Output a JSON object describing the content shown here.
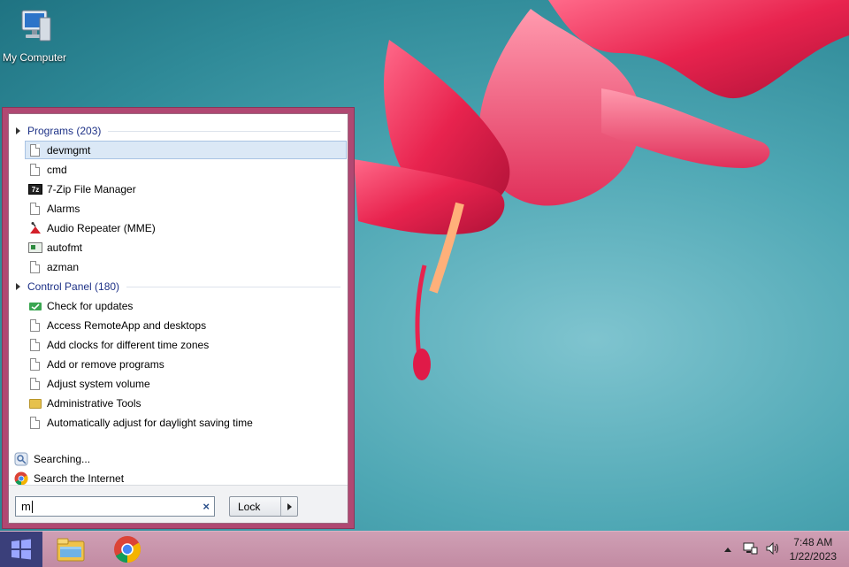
{
  "desktop": {
    "icons": [
      {
        "label": "My Computer",
        "icon": "computer-icon"
      }
    ]
  },
  "start_menu": {
    "groups": [
      {
        "header": "Programs (203)",
        "items": [
          {
            "label": "devmgmt",
            "icon": "document-icon",
            "selected": true
          },
          {
            "label": "cmd",
            "icon": "document-icon"
          },
          {
            "label": "7-Zip File Manager",
            "icon": "7zip-icon"
          },
          {
            "label": "Alarms",
            "icon": "document-icon"
          },
          {
            "label": "Audio Repeater (MME)",
            "icon": "audio-repeater-icon"
          },
          {
            "label": "autofmt",
            "icon": "console-app-icon"
          },
          {
            "label": "azman",
            "icon": "document-icon"
          }
        ]
      },
      {
        "header": "Control Panel (180)",
        "items": [
          {
            "label": "Check for updates",
            "icon": "windows-update-icon"
          },
          {
            "label": "Access RemoteApp and desktops",
            "icon": "document-icon"
          },
          {
            "label": "Add clocks for different time zones",
            "icon": "document-icon"
          },
          {
            "label": "Add or remove programs",
            "icon": "document-icon"
          },
          {
            "label": "Adjust system volume",
            "icon": "document-icon"
          },
          {
            "label": "Administrative Tools",
            "icon": "folder-icon"
          },
          {
            "label": "Automatically adjust for daylight saving time",
            "icon": "document-icon"
          }
        ]
      }
    ],
    "links": [
      {
        "label": "Searching...",
        "icon": "search-progress-icon"
      },
      {
        "label": "Search the Internet",
        "icon": "chrome-icon"
      }
    ],
    "search": {
      "value": "m",
      "clear_symbol": "×"
    },
    "power_button": {
      "label": "Lock"
    }
  },
  "taskbar": {
    "pinned": [
      "file-explorer-icon",
      "chrome-icon"
    ],
    "clock": {
      "time": "7:48 AM",
      "date": "1/22/2023"
    }
  },
  "colors": {
    "start_frame": "#b04872",
    "taskbar": "#c795ab",
    "group_header": "#1e3287",
    "selection": "#dbe8f6"
  }
}
